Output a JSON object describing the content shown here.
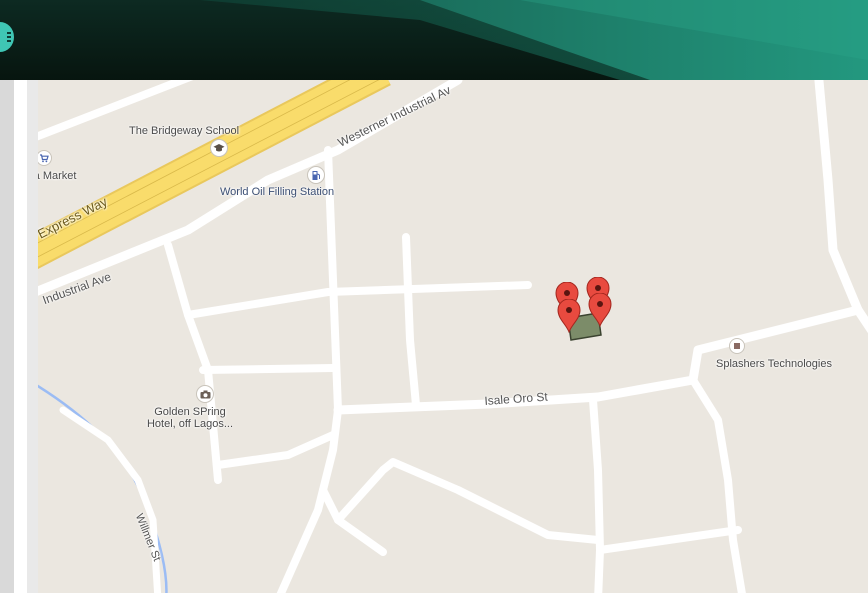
{
  "map": {
    "labels": {
      "bridgeway_school": "The Bridgeway School",
      "market": "ra Market",
      "express_way": "Express Way",
      "world_oil": "World Oil Filling Station",
      "westerner_ave": "Westerner Industrial Av",
      "industrial_ave": "Industrial Ave",
      "isale_oro": "Isale Oro St",
      "splashers": "Splashers Technologies",
      "golden_spring_1": "Golden SPring",
      "golden_spring_2": "Hotel, off Lagos...",
      "willmer": "Willmer St"
    },
    "colors": {
      "land": "#ebe7e0",
      "road": "#ffffff",
      "highway": "#f9dc6b",
      "water": "#9bbcf4",
      "marker": "#e84a3f",
      "parcel": "#7c8c69"
    },
    "icons": [
      "shopping-cart-icon",
      "school-icon",
      "fuel-pump-icon",
      "camera-icon",
      "business-icon",
      "map-marker-icon"
    ],
    "markers_count": 4
  }
}
